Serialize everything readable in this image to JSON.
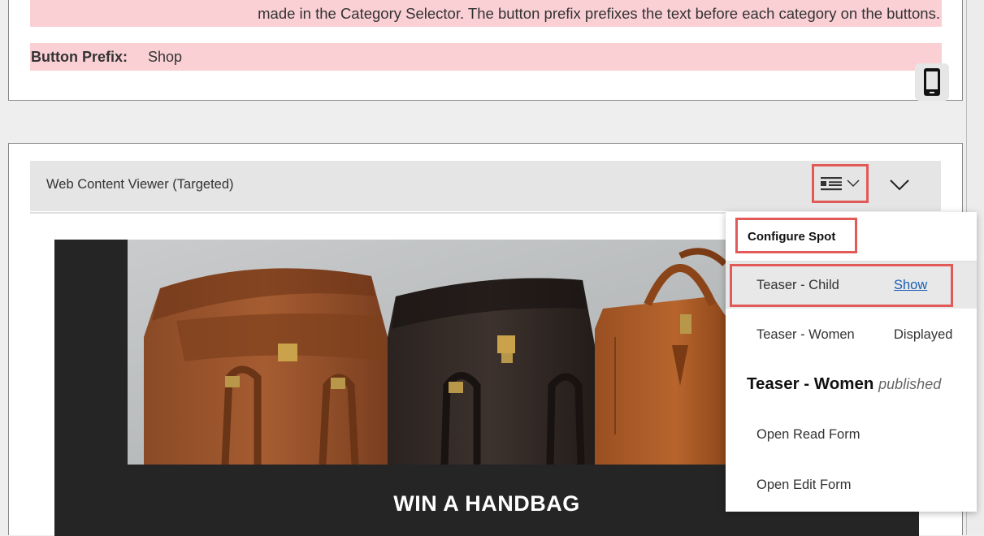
{
  "config_panel": {
    "description": "made in the Category Selector. The button prefix prefixes the text before each category on the buttons.",
    "button_prefix_label": "Button Prefix:",
    "button_prefix_value": "Shop",
    "device_icon": "mobile-phone-icon"
  },
  "portlet": {
    "title": "Web Content Viewer (Targeted)",
    "layout_icon": "layout-list-icon",
    "dropdown_icon": "chevron-down-icon",
    "collapse_icon": "chevron-down-icon"
  },
  "banner": {
    "title": "WIN A HANDBAG",
    "image": "leather-handbags-photo"
  },
  "menu": {
    "configure_spot": "Configure Spot",
    "items": [
      {
        "label": "Teaser - Child",
        "action": "Show"
      },
      {
        "label": "Teaser - Women",
        "status": "Displayed"
      }
    ],
    "published": {
      "label": "Teaser - Women",
      "status": "published"
    },
    "open_read_form": "Open Read Form",
    "open_edit_form": "Open Edit Form"
  },
  "colors": {
    "highlight_border": "#e25a57",
    "pink_band": "#fad0d5",
    "link": "#1a5fb4"
  }
}
